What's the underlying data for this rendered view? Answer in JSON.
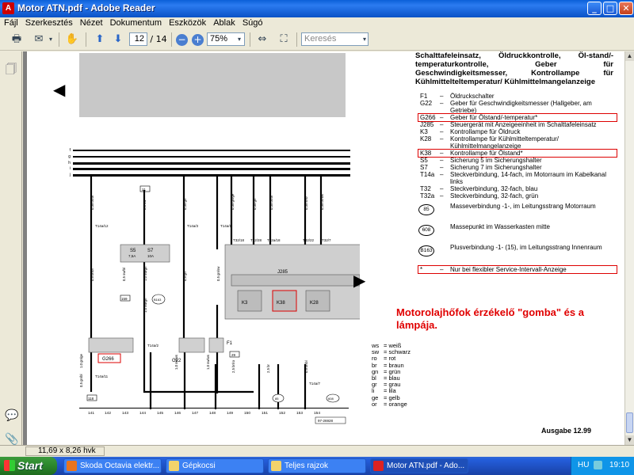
{
  "window": {
    "title": "Motor ATN.pdf - Adobe Reader",
    "app_icon": "adobe-reader-icon",
    "minimize": "_",
    "maximize": "□",
    "close": "✕"
  },
  "menu": [
    "Fájl",
    "Szerkesztés",
    "Nézet",
    "Dokumentum",
    "Eszközök",
    "Ablak",
    "Súgó"
  ],
  "toolbar": {
    "page_current": "12",
    "page_total": "/ 14",
    "zoom": "75%",
    "search_placeholder": "Keresés"
  },
  "document": {
    "heading": "Schalttafeleinsatz, Öldruckkontrolle, Öl-stand/-temperaturkontrolle, Geber für Geschwindigkeitsmesser, Kontrollampe für Kühlmittelteltemperatur/ Kühlmittelmangelanzeige",
    "legend": [
      {
        "code": "F1",
        "text": "Öldruckschalter",
        "highlight": false
      },
      {
        "code": "G22",
        "text": "Geber für Geschwindigkeitsmesser (Hallgeber, am Getriebe)",
        "highlight": false
      },
      {
        "code": "G266",
        "text": "Geber für Ölstand/-temperatur*",
        "highlight": true
      },
      {
        "code": "J285",
        "text": "Steuergerät mit Anzeigeeinheit im Schalttafeleinsatz",
        "highlight": false
      },
      {
        "code": "K3",
        "text": "Kontrollampe für Öldruck",
        "highlight": false
      },
      {
        "code": "K28",
        "text": "Kontrollampe für Kühlmitteltemperatur/ Kühlmittelmangelanzeige",
        "highlight": false
      },
      {
        "code": "K38",
        "text": "Kontrollampe für Ölstand*",
        "highlight": true
      },
      {
        "code": "S5",
        "text": "Sicherung 5 im Sicherungshalter",
        "highlight": false
      },
      {
        "code": "S7",
        "text": "Sicherung 7 im Sicherungshalter",
        "highlight": false
      },
      {
        "code": "T14a",
        "text": "Steckverbindung, 14-fach, im Motorraum im Kabelkanal links",
        "highlight": false
      },
      {
        "code": "T32",
        "text": "Steckverbindung, 32-fach, blau",
        "highlight": false
      },
      {
        "code": "T32a",
        "text": "Steckverbindung, 32-fach, grün",
        "highlight": false
      }
    ],
    "grounds": [
      {
        "code": "85",
        "text": "Masseverbindung -1-, im Leitungsstrang Motorraum"
      },
      {
        "code": "608",
        "text": "Massepunkt im Wasserkasten mitte"
      },
      {
        "code": "B163",
        "text": "Plusverbindung -1- (15), im Leitungsstrang Innenraum"
      }
    ],
    "footnote": "Nur bei flexibler Service-Intervall-Anzeige",
    "footnote_mark": "*",
    "annotation": "Motorolajhőfok érzékelő \"gomba\" és a lámpája.",
    "color_codes": [
      {
        "ab": "ws",
        "name": "weiß"
      },
      {
        "ab": "sw",
        "name": "schwarz"
      },
      {
        "ab": "ro",
        "name": "rot"
      },
      {
        "ab": "br",
        "name": "braun"
      },
      {
        "ab": "gn",
        "name": "grün"
      },
      {
        "ab": "bl",
        "name": "blau"
      },
      {
        "ab": "gr",
        "name": "grau"
      },
      {
        "ab": "li",
        "name": "lila"
      },
      {
        "ab": "ge",
        "name": "gelb"
      },
      {
        "ab": "or",
        "name": "orange"
      }
    ],
    "ausgabe": "Ausgabe 12.99",
    "diagram": {
      "bus_labels": [
        "f",
        "g",
        "h",
        "i",
        "j"
      ],
      "bottom_numbers": [
        "141",
        "142",
        "143",
        "144",
        "145",
        "146",
        "147",
        "148",
        "149",
        "150",
        "151",
        "152",
        "153",
        "154"
      ],
      "ref_code": "97-26928",
      "components": {
        "g266": "G266",
        "g22": "G22",
        "j285": "J285",
        "k3": "K3",
        "k38": "K38",
        "k28": "K28",
        "f1": "F1",
        "s5": "S5",
        "s7": "S7",
        "s5a": "7,5A",
        "s7a": "10A"
      },
      "connectors": [
        "T14a/12",
        "T14a/3",
        "T14a/1",
        "T14a/2",
        "T14a/11",
        "T14a/7",
        "T32/18",
        "T32/28",
        "T32a/18",
        "T32/22",
        "T32/7"
      ],
      "wire_labels": {
        "w1": "0,35 br/bl",
        "w2": "2,5 sw",
        "w3": "0,35 gn",
        "w4": "0,35 gn/ge",
        "w5": "0,35 gn",
        "w6": "0,35 br/bl",
        "w7": "0,35 li/ro",
        "w8": "0,35 br/ws",
        "w9": "0,5 br/bl",
        "w10": "0,5 sw/bl",
        "w11": "1,0 sw/gn",
        "w12": "0,5 gn",
        "w13": "0,5 gn/sw",
        "w14": "1,0 sw/gn",
        "w15": "1,0 gn/ge",
        "w16": "0,5 gn/bl",
        "w17": "1,0 sw/ws",
        "w18": "1,0 sw/ws",
        "w19": "2,5 br/ro",
        "w20": "2,5 br",
        "w21": "0,5 br/bl"
      },
      "grounds": [
        "85",
        "608",
        "B163"
      ],
      "small_boxes": [
        "21",
        "159",
        "29",
        "118"
      ]
    }
  },
  "statusbar": {
    "page_size": "11,69 x 8,26 hvk"
  },
  "taskbar": {
    "start": "Start",
    "buttons": [
      {
        "label": "Skoda Octavia elektr...",
        "active": false
      },
      {
        "label": "Gépkocsi",
        "active": false
      },
      {
        "label": "Teljes rajzok",
        "active": false
      },
      {
        "label": "Motor ATN.pdf - Ado...",
        "active": true
      }
    ],
    "lang": "HU",
    "clock": "19:10"
  }
}
